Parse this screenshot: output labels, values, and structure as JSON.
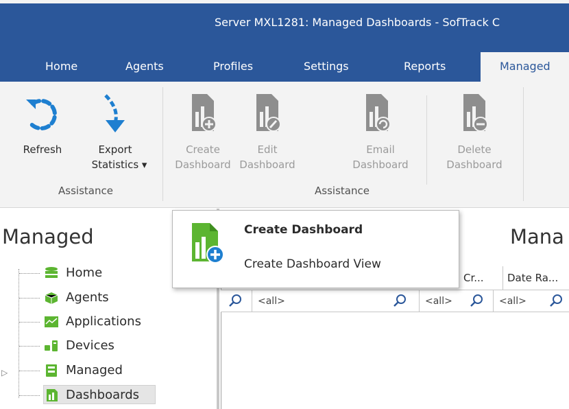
{
  "window": {
    "title": "Server MXL1281: Managed Dashboards - SofTrack C"
  },
  "tabs": [
    {
      "label": "Home"
    },
    {
      "label": "Agents"
    },
    {
      "label": "Profiles"
    },
    {
      "label": "Settings"
    },
    {
      "label": "Reports"
    },
    {
      "label": "Managed"
    }
  ],
  "ribbon": {
    "refresh": "Refresh",
    "export_line1": "Export",
    "export_line2": "Statistics ▾",
    "group1_label": "Assistance",
    "create_line1": "Create",
    "create_line2": "Dashboard",
    "edit_line1": "Edit",
    "edit_line2": "Dashboard",
    "email_line1": "Email",
    "email_line2": "Dashboard",
    "delete_line1": "Delete",
    "delete_line2": "Dashboard",
    "group2_label": "Assistance"
  },
  "left_panel": {
    "title": "Managed",
    "items": [
      {
        "label": "Home",
        "icon": "database-icon"
      },
      {
        "label": "Agents",
        "icon": "cube-icon"
      },
      {
        "label": "Applications",
        "icon": "applications-icon"
      },
      {
        "label": "Devices",
        "icon": "devices-icon"
      },
      {
        "label": "Managed",
        "icon": "managed-icon"
      },
      {
        "label": "Dashboards",
        "icon": "dashboard-icon"
      }
    ]
  },
  "main": {
    "title": "Mana",
    "columns": [
      {
        "label": "Cr..."
      },
      {
        "label": "Date Ra..."
      }
    ],
    "filters": [
      {
        "value": "<all>"
      },
      {
        "value": "<all>"
      },
      {
        "value": "<all>"
      }
    ]
  },
  "popup": {
    "item1": "Create Dashboard",
    "item2": "Create Dashboard View"
  },
  "colors": {
    "accent": "#2b579a",
    "ribbon_bg": "#f3f3f3",
    "green": "#5cb531",
    "blue": "#1e7fd0"
  }
}
